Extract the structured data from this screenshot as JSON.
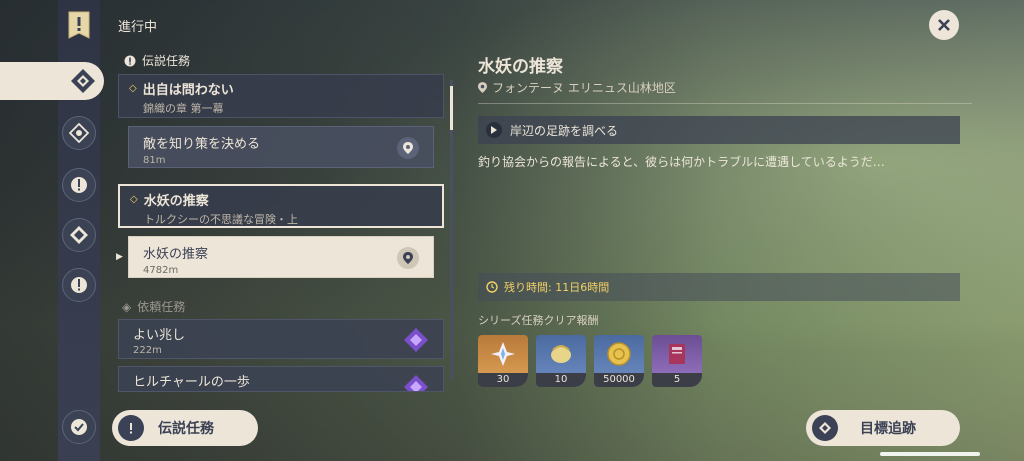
{
  "header": {
    "in_progress": "進行中"
  },
  "list": {
    "legend_header": "伝説任務",
    "quests": [
      {
        "title": "出自は問わない",
        "subtitle": "錦織の章 第一幕",
        "step": {
          "label": "敵を知り策を決める",
          "distance": "81m"
        }
      },
      {
        "title": "水妖の推察",
        "subtitle": "トルクシーの不思議な冒険・上",
        "step": {
          "label": "水妖の推察",
          "distance": "4782m"
        }
      }
    ],
    "request_header": "依頼任務",
    "requests": [
      {
        "label": "よい兆し",
        "distance": "222m"
      },
      {
        "label": "ヒルチャールの一歩",
        "distance": ""
      }
    ]
  },
  "bottom": {
    "filter_label": "伝説任務",
    "track_label": "目標追跡"
  },
  "detail": {
    "title": "水妖の推察",
    "location": "フォンテーヌ エリニュス山林地区",
    "objective": "岸辺の足跡を調べる",
    "description": "釣り協会からの報告によると、彼らは何かトラブルに遭遇しているようだ…",
    "time_remaining": "残り時間: 11日6時間",
    "rewards_label": "シリーズ任務クリア報酬",
    "rewards": [
      {
        "icon": "primogem-icon",
        "count": "30"
      },
      {
        "icon": "hero-wit-icon",
        "count": "10"
      },
      {
        "icon": "mora-icon",
        "count": "50000"
      },
      {
        "icon": "book-icon",
        "count": "5"
      }
    ]
  },
  "colors": {
    "accent": "#ece5d8",
    "panel": "#3b4255",
    "time": "#f2d166"
  }
}
